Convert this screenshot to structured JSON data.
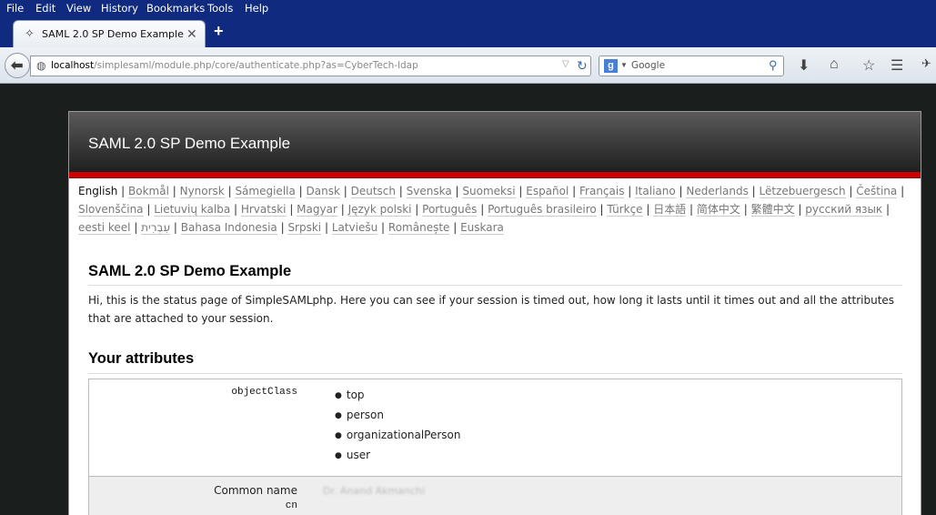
{
  "menu": [
    "File",
    "Edit",
    "View",
    "History",
    "Bookmarks",
    "Tools",
    "Help"
  ],
  "tab": {
    "title": "SAML 2.0 SP Demo Example",
    "favicon": "puzzle-icon"
  },
  "nav": {
    "url_host": "localhost",
    "url_path": "/simplesaml/module.php/core/authenticate.php?as=CyberTech-ldap",
    "search_placeholder": "Google"
  },
  "page": {
    "header_title": "SAML 2.0 SP Demo Example",
    "current_language": "English",
    "languages": [
      "Bokmål",
      "Nynorsk",
      "Sámegiella",
      "Dansk",
      "Deutsch",
      "Svenska",
      "Suomeksi",
      "Español",
      "Français",
      "Italiano",
      "Nederlands",
      "Lëtzebuergesch",
      "Čeština",
      "Slovenščina",
      "Lietuvių kalba",
      "Hrvatski",
      "Magyar",
      "Język polski",
      "Português",
      "Português brasileiro",
      "Türkçe",
      "日本語",
      "简体中文",
      "繁體中文",
      "русский язык",
      "eesti keel",
      "עִבְרִית",
      "Bahasa Indonesia",
      "Srpski",
      "Latviešu",
      "Românește",
      "Euskara"
    ],
    "heading": "SAML 2.0 SP Demo Example",
    "intro": "Hi, this is the status page of SimpleSAMLphp. Here you can see if your session is timed out, how long it lasts until it times out and all the attributes that are attached to your session.",
    "attributes_heading": "Your attributes",
    "attributes": [
      {
        "key": "objectClass",
        "values": [
          "top",
          "person",
          "organizationalPerson",
          "user"
        ]
      },
      {
        "name": "Common name",
        "key": "cn",
        "value": "Dr. Anand Akmanchi"
      }
    ]
  },
  "colors": {
    "menubar": "#0f2a7e",
    "header_red": "#cc0000"
  }
}
